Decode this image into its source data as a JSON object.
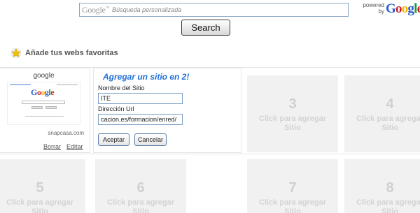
{
  "search": {
    "logo_text": "Google",
    "placeholder": "Búsqueda personalizada",
    "button_label": "Search",
    "powered_by": "powered by",
    "powered_logo": "Google"
  },
  "favorites": {
    "heading": "Añade tus webs favoritas"
  },
  "site_tile": {
    "title": "google",
    "thumbnail_logo": "Google",
    "url": "snapcasa.com",
    "delete_label": "Borrar",
    "edit_label": "Editar"
  },
  "add_form": {
    "title": "Agregar un sitio en 2!",
    "name_label": "Nombre del Sitio",
    "name_value": "ITE",
    "url_label": "Dirección Url",
    "url_value": "cacion.es/formacion/enred/",
    "accept_label": "Aceptar",
    "cancel_label": "Cancelar"
  },
  "slots": [
    {
      "number": "3",
      "text": "Click para agregar Sitio"
    },
    {
      "number": "4",
      "text": "Click para agregar Sitio"
    },
    {
      "number": "5",
      "text": "Click para agregar Sitio"
    },
    {
      "number": "6",
      "text": "Click para agregar Sitio"
    },
    {
      "number": "7",
      "text": "Click para agregar Sitio"
    },
    {
      "number": "8",
      "text": "Click para agregar Sitio"
    }
  ],
  "colors": {
    "form_title": "#1e6fd8",
    "placeholder_bg": "#f1f1f1",
    "google_blue": "#2a5ccb",
    "google_red": "#d2232a",
    "google_yellow": "#f5b400",
    "google_green": "#1d9a3c"
  }
}
